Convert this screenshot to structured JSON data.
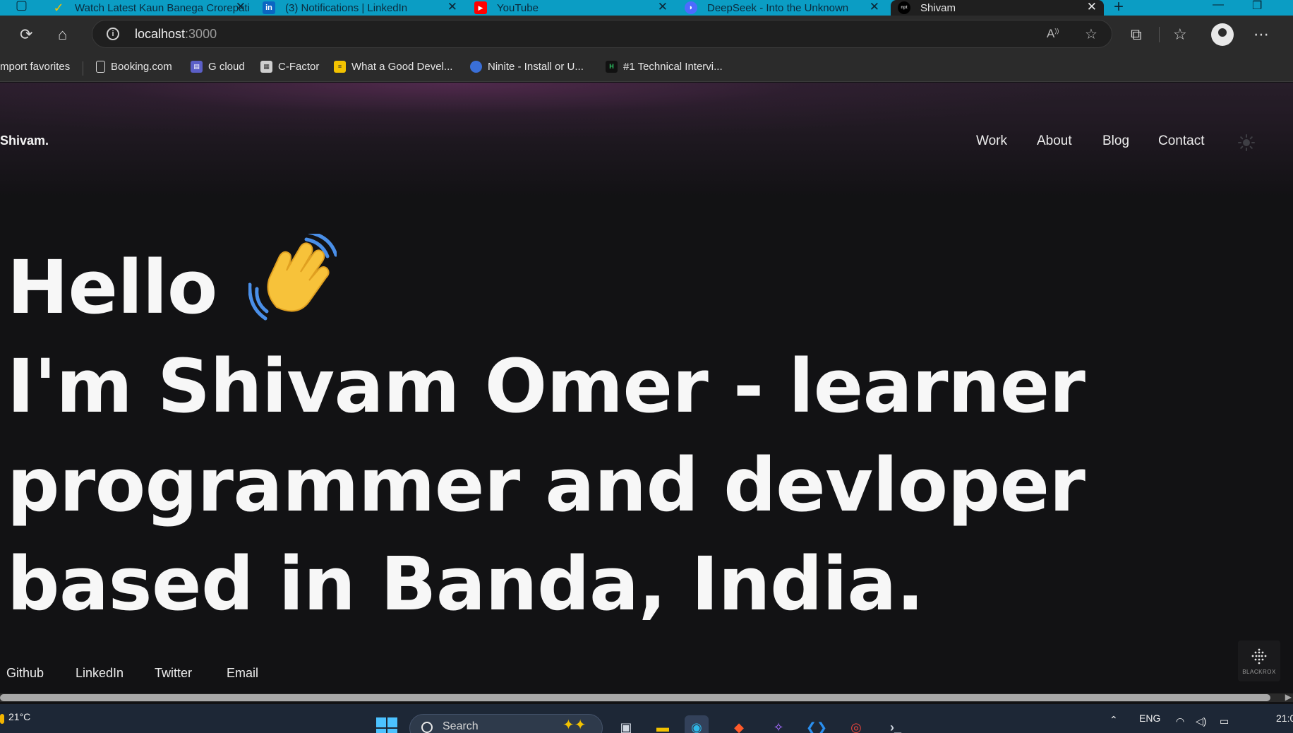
{
  "browser": {
    "tabs": [
      {
        "title": "Watch Latest Kaun Banega Crorepati",
        "favicon": "check-favicon",
        "active": false
      },
      {
        "title": "(3) Notifications | LinkedIn",
        "favicon": "linkedin-favicon",
        "active": false
      },
      {
        "title": "YouTube",
        "favicon": "youtube-favicon",
        "active": false
      },
      {
        "title": "DeepSeek - Into the Unknown",
        "favicon": "deepseek-favicon",
        "active": false
      },
      {
        "title": "Shivam",
        "favicon": "site-favicon",
        "active": true
      }
    ],
    "address": {
      "host": "localhost",
      "port": ":3000"
    },
    "favorites": [
      {
        "label": "mport favorites",
        "icon": "none"
      },
      {
        "label": "Booking.com",
        "icon": "page-icon"
      },
      {
        "label": "G cloud",
        "icon": "gcloud-icon"
      },
      {
        "label": "C-Factor",
        "icon": "cfactor-icon"
      },
      {
        "label": "What a Good Devel...",
        "icon": "doc-icon"
      },
      {
        "label": "Ninite - Install or U...",
        "icon": "ninite-icon"
      },
      {
        "label": "#1 Technical Intervi...",
        "icon": "hackerrank-icon"
      }
    ]
  },
  "site": {
    "brand": "Shivam.",
    "nav": [
      "Work",
      "About",
      "Blog",
      "Contact"
    ],
    "hero": {
      "line1": "Hello",
      "line2": "I'm Shivam Omer - learner",
      "line3": "programmer and devloper",
      "line4": "based in Banda, India."
    },
    "socials": [
      "Github",
      "LinkedIn",
      "Twitter",
      "Email"
    ],
    "badge": "BLACKROX"
  },
  "taskbar": {
    "temperature": "21°C",
    "search_placeholder": "Search",
    "language": "ENG",
    "clock": "21:0"
  },
  "colors": {
    "tabbar": "#0b9dc4",
    "page_bg": "#121214",
    "text": "#f7f7f7",
    "taskbar": "#1d2736"
  }
}
